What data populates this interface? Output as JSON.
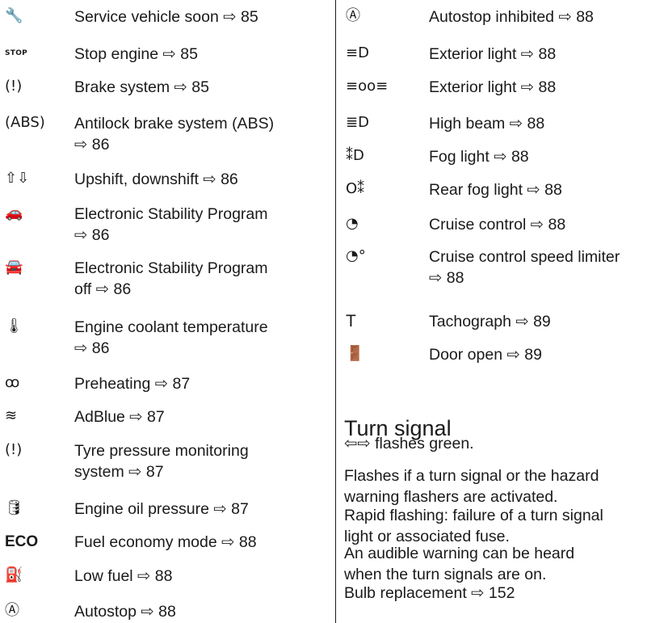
{
  "arrow": "⇨",
  "left_items": [
    {
      "icon": "🔧",
      "icon_name": "wrench-icon",
      "lines": [
        "Service vehicle soon ⇨ 85"
      ]
    },
    {
      "icon": "STOP",
      "icon_name": "stop-icon",
      "lines": [
        "Stop engine ⇨ 85"
      ]
    },
    {
      "icon": "(!)",
      "icon_name": "brake-system-icon",
      "lines": [
        "Brake system ⇨ 85"
      ]
    },
    {
      "icon": "(ABS)",
      "icon_name": "abs-icon",
      "lines": [
        "Antilock brake system (ABS)",
        "⇨ 86"
      ]
    },
    {
      "icon": "⇧⇩",
      "icon_name": "shift-icon",
      "lines": [
        "Upshift, downshift ⇨ 86"
      ]
    },
    {
      "icon": "🚗",
      "icon_name": "esp-icon",
      "lines": [
        "Electronic Stability Program",
        "⇨ 86"
      ]
    },
    {
      "icon": "🚘",
      "icon_name": "esp-off-icon",
      "lines": [
        "Electronic Stability Program",
        "off ⇨ 86"
      ]
    },
    {
      "icon": "🌡",
      "icon_name": "coolant-temperature-icon",
      "lines": [
        "Engine coolant temperature",
        "⇨ 86"
      ]
    },
    {
      "icon": "ꝏ",
      "icon_name": "preheating-icon",
      "lines": [
        "Preheating ⇨ 87"
      ]
    },
    {
      "icon": "≋",
      "icon_name": "adblue-icon",
      "lines": [
        "AdBlue ⇨ 87"
      ]
    },
    {
      "icon": "(!)",
      "icon_name": "tyre-pressure-icon",
      "lines": [
        "Tyre pressure monitoring",
        "system ⇨ 87"
      ]
    },
    {
      "icon": "🛢",
      "icon_name": "oil-pressure-icon",
      "lines": [
        "Engine oil pressure ⇨ 87"
      ]
    },
    {
      "icon": "ECO",
      "icon_name": "eco-icon",
      "lines": [
        "Fuel economy mode ⇨ 88"
      ]
    },
    {
      "icon": "⛽",
      "icon_name": "low-fuel-icon",
      "lines": [
        "Low fuel ⇨ 88"
      ]
    },
    {
      "icon": "Ⓐ",
      "icon_name": "autostop-icon",
      "lines": [
        "Autostop ⇨ 88"
      ]
    }
  ],
  "right_items": [
    {
      "icon": "Ⓐ",
      "icon_name": "autostop-inhibited-icon",
      "lines": [
        "Autostop inhibited ⇨ 88"
      ]
    },
    {
      "icon": "≡D",
      "icon_name": "exterior-light-icon",
      "lines": [
        "Exterior light ⇨ 88"
      ]
    },
    {
      "icon": "≡oo≡",
      "icon_name": "parking-light-icon",
      "lines": [
        "Exterior light ⇨ 88"
      ]
    },
    {
      "icon": "≣D",
      "icon_name": "high-beam-icon",
      "lines": [
        "High beam ⇨ 88"
      ]
    },
    {
      "icon": "⁑D",
      "icon_name": "fog-light-icon",
      "lines": [
        "Fog light ⇨ 88"
      ]
    },
    {
      "icon": "O⁑",
      "icon_name": "rear-fog-light-icon",
      "lines": [
        "Rear fog light ⇨ 88"
      ]
    },
    {
      "icon": "◔",
      "icon_name": "cruise-control-icon",
      "lines": [
        "Cruise control ⇨ 88"
      ]
    },
    {
      "icon": "◔°",
      "icon_name": "speed-limiter-icon",
      "lines": [
        "Cruise control speed limiter",
        "⇨ 88"
      ]
    },
    {
      "icon": "T",
      "icon_name": "tachograph-icon",
      "lines": [
        "Tachograph ⇨ 89"
      ]
    },
    {
      "icon": "🚪",
      "icon_name": "door-open-icon",
      "lines": [
        "Door open ⇨ 89"
      ]
    }
  ],
  "turn_signal": {
    "heading": "Turn signal",
    "paragraphs": [
      [
        "⇦⇨ flashes green."
      ],
      [
        "Flashes if a turn signal or the hazard",
        "warning flashers are activated."
      ],
      [
        "Rapid flashing: failure of a turn signal",
        "light or associated fuse."
      ],
      [
        "An audible warning can be heard",
        "when the turn signals are on."
      ],
      [
        "Bulb replacement ⇨ 152"
      ]
    ]
  }
}
